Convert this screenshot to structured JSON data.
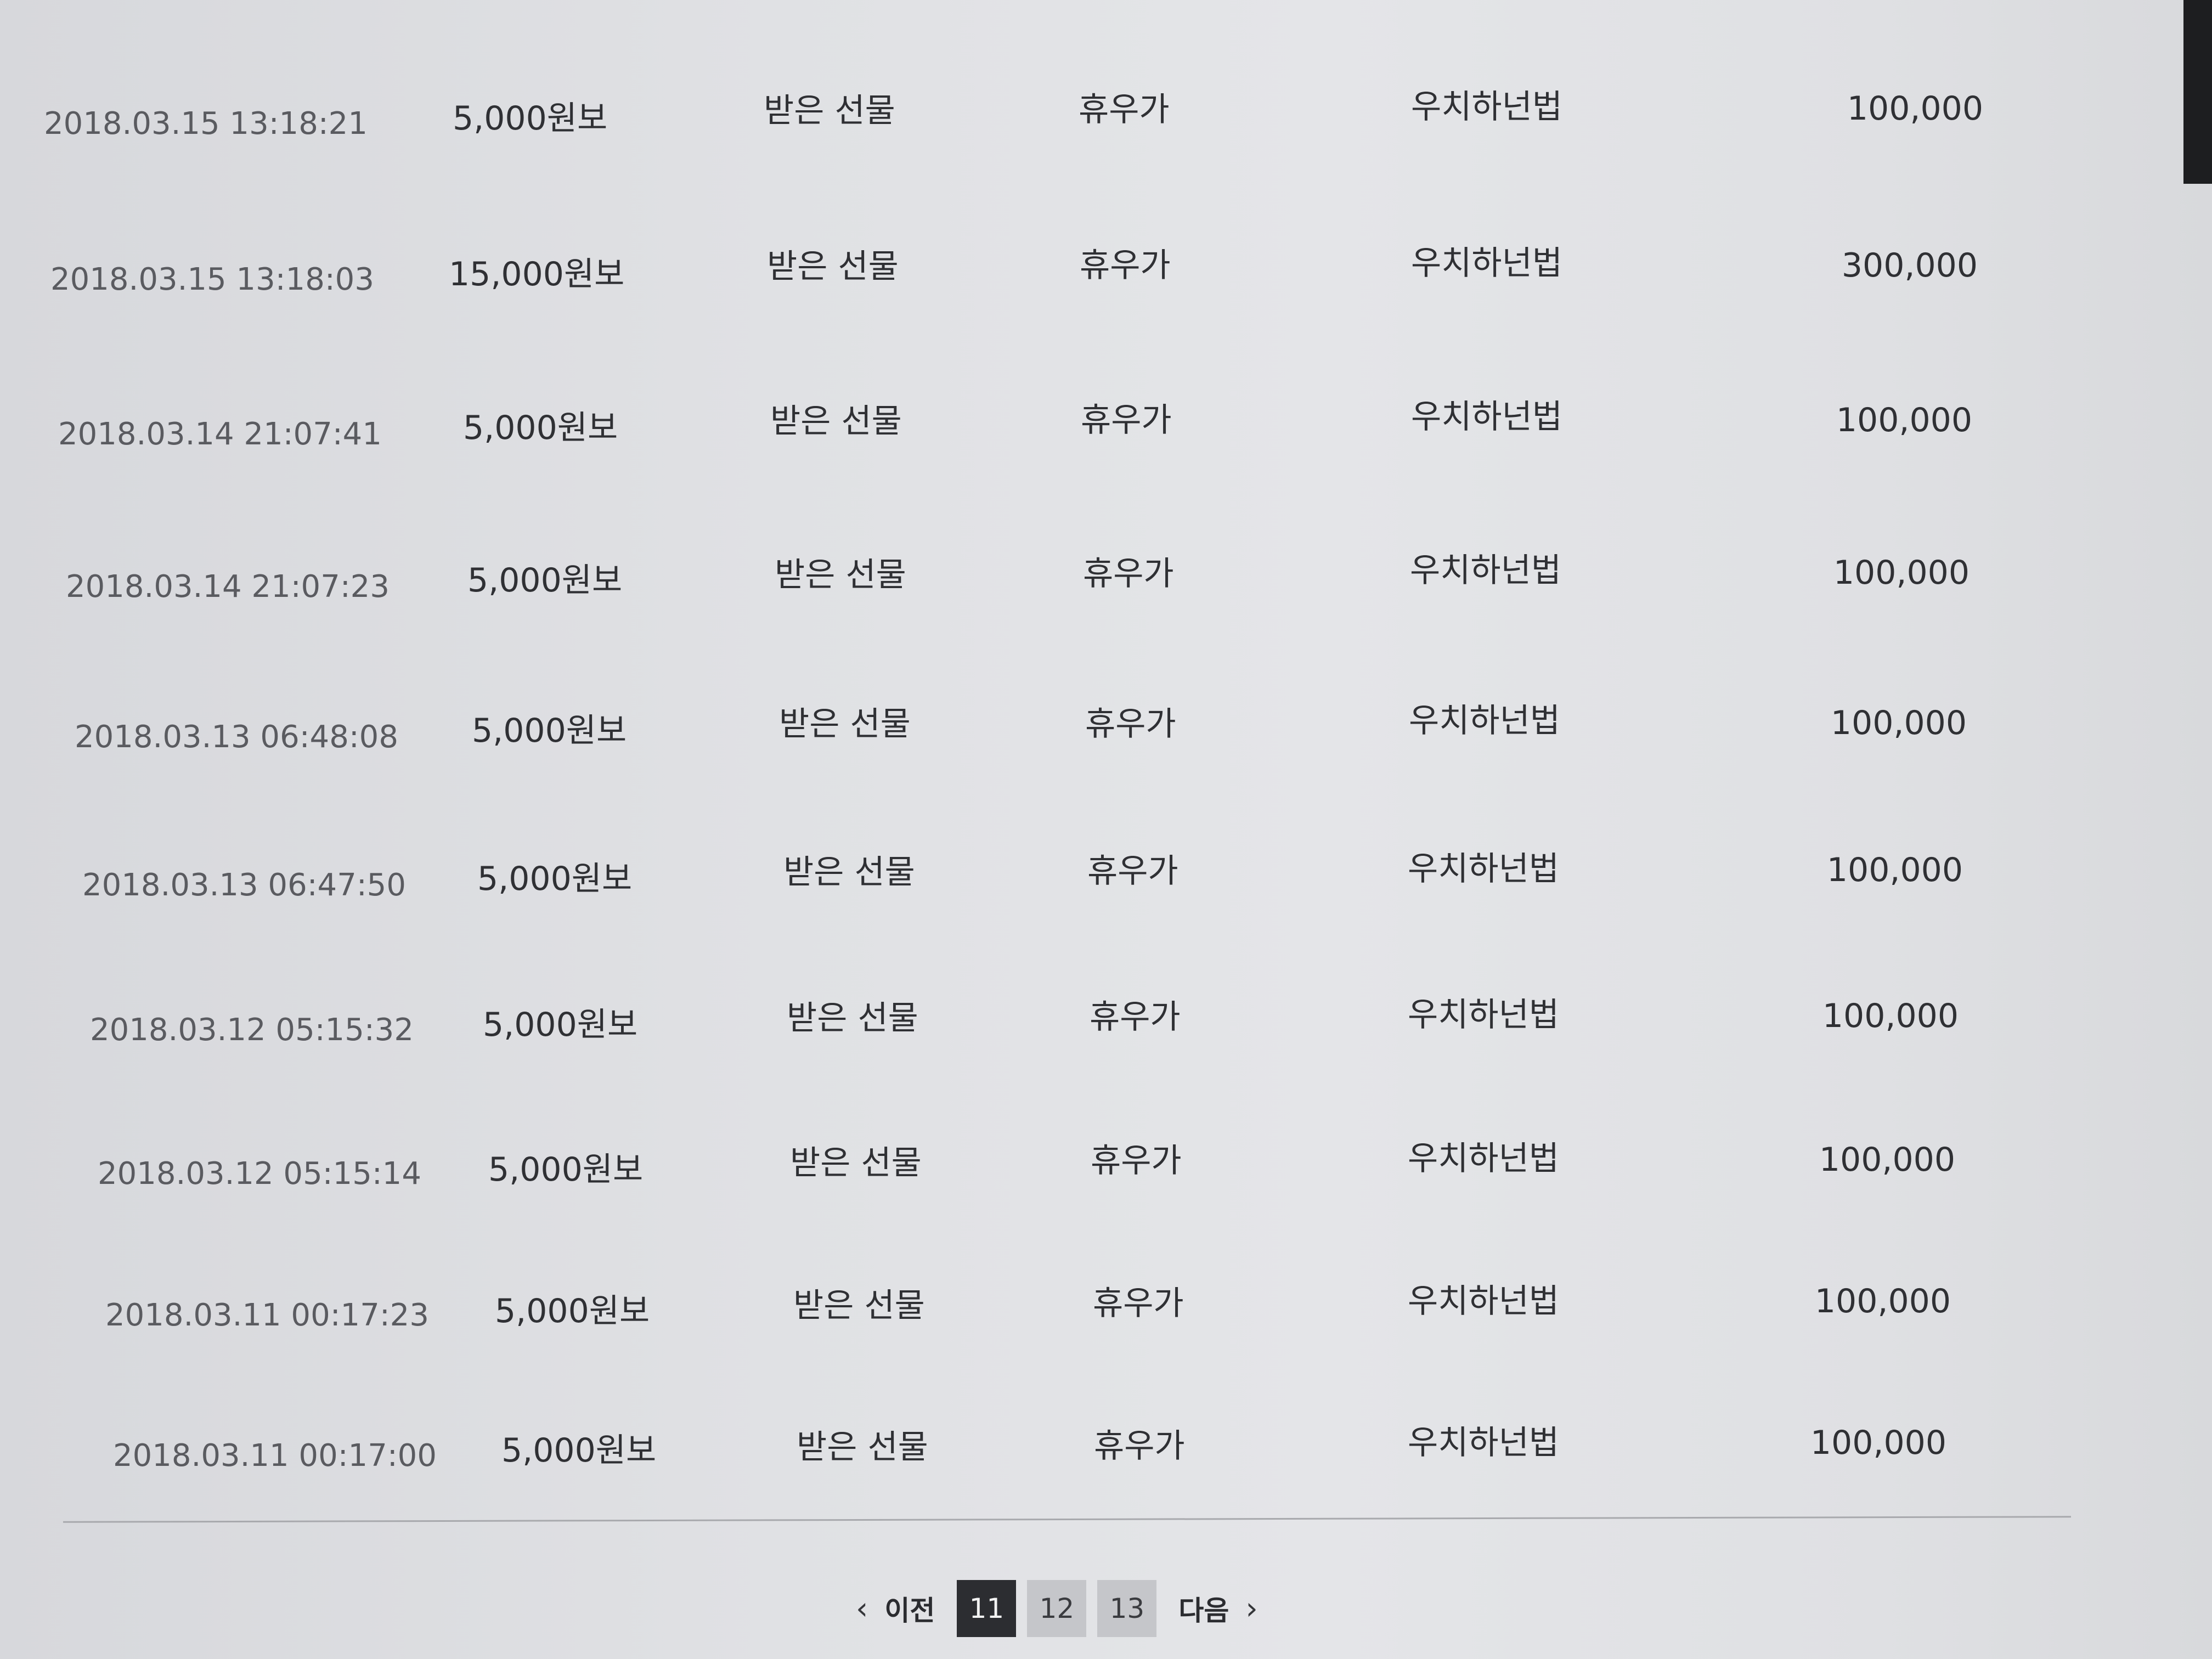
{
  "rows": [
    {
      "date": "2018.03.15 13:18:21",
      "amount": "5,000원보",
      "type": "받은 선물",
      "name": "휴우가",
      "user": "우치하넌법",
      "points": "100,000"
    },
    {
      "date": "2018.03.15 13:18:03",
      "amount": "15,000원보",
      "type": "받은 선물",
      "name": "휴우가",
      "user": "우치하넌법",
      "points": "300,000"
    },
    {
      "date": "2018.03.14 21:07:41",
      "amount": "5,000원보",
      "type": "받은 선물",
      "name": "휴우가",
      "user": "우치하넌법",
      "points": "100,000"
    },
    {
      "date": "2018.03.14 21:07:23",
      "amount": "5,000원보",
      "type": "받은 선물",
      "name": "휴우가",
      "user": "우치하넌법",
      "points": "100,000"
    },
    {
      "date": "2018.03.13 06:48:08",
      "amount": "5,000원보",
      "type": "받은 선물",
      "name": "휴우가",
      "user": "우치하넌법",
      "points": "100,000"
    },
    {
      "date": "2018.03.13 06:47:50",
      "amount": "5,000원보",
      "type": "받은 선물",
      "name": "휴우가",
      "user": "우치하넌법",
      "points": "100,000"
    },
    {
      "date": "2018.03.12 05:15:32",
      "amount": "5,000원보",
      "type": "받은 선물",
      "name": "휴우가",
      "user": "우치하넌법",
      "points": "100,000"
    },
    {
      "date": "2018.03.12 05:15:14",
      "amount": "5,000원보",
      "type": "받은 선물",
      "name": "휴우가",
      "user": "우치하넌법",
      "points": "100,000"
    },
    {
      "date": "2018.03.11 00:17:23",
      "amount": "5,000원보",
      "type": "받은 선물",
      "name": "휴우가",
      "user": "우치하넌법",
      "points": "100,000"
    },
    {
      "date": "2018.03.11 00:17:00",
      "amount": "5,000원보",
      "type": "받은 선물",
      "name": "휴우가",
      "user": "우치하넌법",
      "points": "100,000"
    }
  ],
  "pagination": {
    "prev_label": "이전",
    "next_label": "다음",
    "prev_icon": "chevron-left-icon",
    "next_icon": "chevron-right-icon",
    "pages": [
      "11",
      "12",
      "13"
    ],
    "current": "11"
  },
  "colors": {
    "active_page_bg": "#2c2d31",
    "page_bg": "#c5c6ca",
    "text": "#2f3034"
  }
}
